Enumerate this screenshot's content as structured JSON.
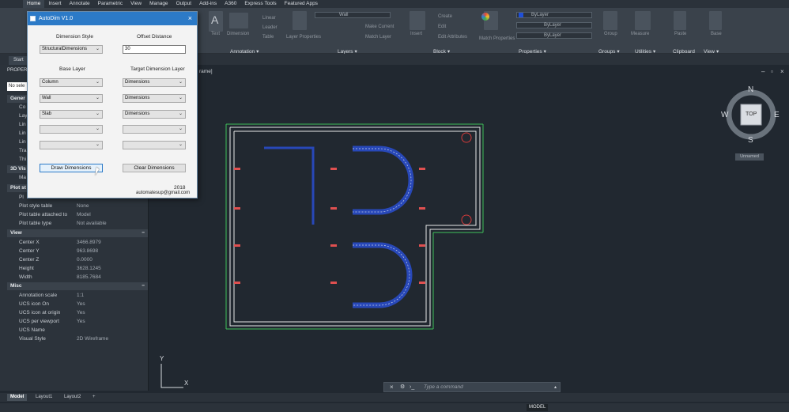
{
  "menu": {
    "tabs": [
      "Home",
      "Insert",
      "Annotate",
      "Parametric",
      "View",
      "Manage",
      "Output",
      "Add-ins",
      "A360",
      "Express Tools",
      "Featured Apps"
    ],
    "active": "Home"
  },
  "ribbon": {
    "groups": [
      "Annotation",
      "Layers",
      "Block",
      "Properties",
      "Groups",
      "Utilities",
      "Clipboard",
      "View"
    ],
    "layer_value": "Wall",
    "bylayer_1": "ByLayer",
    "bylayer_2": "ByLayer",
    "bylayer_3": "ByLayer",
    "make_current": "Make Current",
    "match_layer": "Match Layer",
    "create": "Create",
    "edit": "Edit",
    "edit_attributes": "Edit Attributes",
    "match_properties": "Match Properties",
    "measure": "Measure",
    "paste": "Paste",
    "base": "Base",
    "group": "Group",
    "text": "Text",
    "dimension": "Dimension",
    "linear": "Linear",
    "leader": "Leader",
    "table": "Table",
    "layer_properties": "Layer Properties",
    "insert": "Insert"
  },
  "file_tab": {
    "label": "Start"
  },
  "properties": {
    "title": "PROPER",
    "selection": "No sele",
    "general_section": "Gener",
    "cut_rows": [
      "Co",
      "Lay",
      "Lin",
      "Lin",
      "Lin",
      "Tra",
      "Thi"
    ],
    "vis_section": "3D Vis",
    "vis_row": "Ma",
    "plot_section": "Plot st",
    "plot_rows": [
      {
        "key": "Pl",
        "value": ""
      },
      {
        "key": "Plot style table",
        "value": "None"
      },
      {
        "key": "Plot table attached to",
        "value": "Model"
      },
      {
        "key": "Plot table type",
        "value": "Not available"
      }
    ],
    "view_section": "View",
    "view_rows": [
      {
        "key": "Center X",
        "value": "3466.8979"
      },
      {
        "key": "Center Y",
        "value": "963.8698"
      },
      {
        "key": "Center Z",
        "value": "0.0000"
      },
      {
        "key": "Height",
        "value": "3628.1245"
      },
      {
        "key": "Width",
        "value": "8185.7684"
      }
    ],
    "misc_section": "Misc",
    "misc_rows": [
      {
        "key": "Annotation scale",
        "value": "1:1"
      },
      {
        "key": "UCS icon On",
        "value": "Yes"
      },
      {
        "key": "UCS icon at origin",
        "value": "Yes"
      },
      {
        "key": "UCS per viewport",
        "value": "Yes"
      },
      {
        "key": "UCS Name",
        "value": ""
      },
      {
        "key": "Visual Style",
        "value": "2D Wireframe"
      }
    ]
  },
  "viewport": {
    "label": "rame]",
    "viewcube": {
      "n": "N",
      "s": "S",
      "e": "E",
      "w": "W",
      "top": "TOP",
      "ucs": "Unnamed"
    },
    "ucs_y": "Y",
    "ucs_x": "X"
  },
  "command": {
    "placeholder": "Type a command"
  },
  "layout_tabs": [
    "Model",
    "Layout1",
    "Layout2"
  ],
  "status": {
    "model": "MODEL"
  },
  "dialog": {
    "title": "AutoDim V1.0",
    "dimension_style_label": "Dimension Style",
    "dimension_style_value": "StructuralDimensions",
    "offset_distance_label": "Offset Distance",
    "offset_distance_value": "30",
    "base_layer_label": "Base Layer",
    "target_layer_label": "Target Dimension Layer",
    "base_layers": [
      "Column",
      "Wall",
      "Slab",
      "",
      ""
    ],
    "target_layers": [
      "Dimensions",
      "Dimensions",
      "Dimensions",
      "",
      ""
    ],
    "draw_button": "Draw Dimensions",
    "clear_button": "Clear Dimensions",
    "year": "2018",
    "email": "automatesup@gmail.com"
  }
}
